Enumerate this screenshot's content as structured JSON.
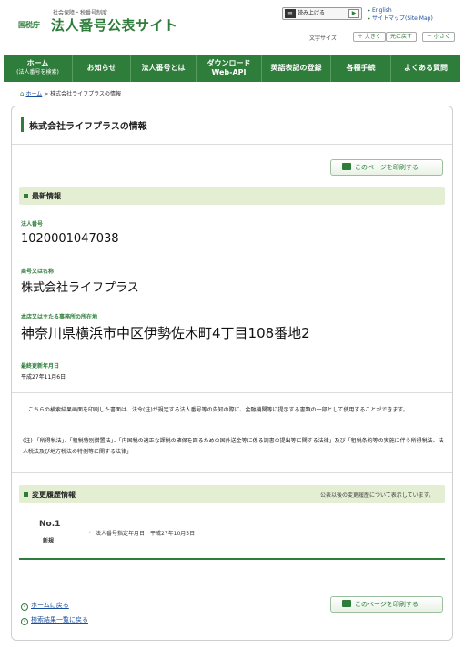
{
  "header": {
    "logo_small": "社会保障・税番号制度",
    "logo_agency": "国税庁",
    "logo_site": "法人番号公表サイト",
    "read_aloud": "読み上げる",
    "link_english": "English",
    "link_sitemap": "サイトマップ(Site Map)",
    "font_size_label": "文字サイズ",
    "font_larger": "＋ 大きく",
    "font_reset": "元に戻す",
    "font_smaller": "－ 小さく"
  },
  "nav": {
    "items": [
      {
        "label": "ホーム",
        "sub": "(法人番号を検索)"
      },
      {
        "label": "お知らせ"
      },
      {
        "label": "法人番号とは"
      },
      {
        "label": "ダウンロード",
        "sub": "Web-API"
      },
      {
        "label": "英語表記の登録"
      },
      {
        "label": "各種手続"
      },
      {
        "label": "よくある質問"
      }
    ]
  },
  "breadcrumb": {
    "home": "ホーム",
    "separator": ">",
    "current": "株式会社ライフプラスの情報"
  },
  "page": {
    "title": "株式会社ライフプラスの情報",
    "print_label": "このページを印刷する"
  },
  "latest": {
    "heading": "最新情報",
    "number_label": "法人番号",
    "number_value": "1020001047038",
    "name_label": "商号又は名称",
    "name_value": "株式会社ライフプラス",
    "address_label": "本店又は主たる事務所の所在地",
    "address_value": "神奈川県横浜市中区伊勢佐木町4丁目108番地2",
    "updated_label": "最終更新年月日",
    "updated_value": "平成27年11月6日"
  },
  "notice": {
    "paragraph": "こちらの検索結果画面を印刷した書面は、法令(注)が規定する法人番号等の告知の際に、金融機関等に提示する書類の一部として使用することができます。",
    "note_mark": "(注)",
    "note_text": "「所得税法」、「租税特別措置法」、「内国税の適正な課税の確保を図るための国外送金等に係る調書の提出等に関する法律」及び「租税条約等の実施に伴う所得税法、法人税法及び地方税法の特例等に関する法律」"
  },
  "history": {
    "heading": "変更履歴情報",
    "note": "公表以後の変更履歴について表示しています。",
    "entries": [
      {
        "no": "No.1",
        "kind": "新規",
        "item": "法人番号指定年月日　平成27年10月5日"
      }
    ]
  },
  "footer_links": {
    "home": "ホームに戻る",
    "results": "検索結果一覧に戻る"
  },
  "colors": {
    "brand_green": "#2f7d3b",
    "section_bg": "#e4eed2",
    "link_blue": "#1a4e9e"
  }
}
